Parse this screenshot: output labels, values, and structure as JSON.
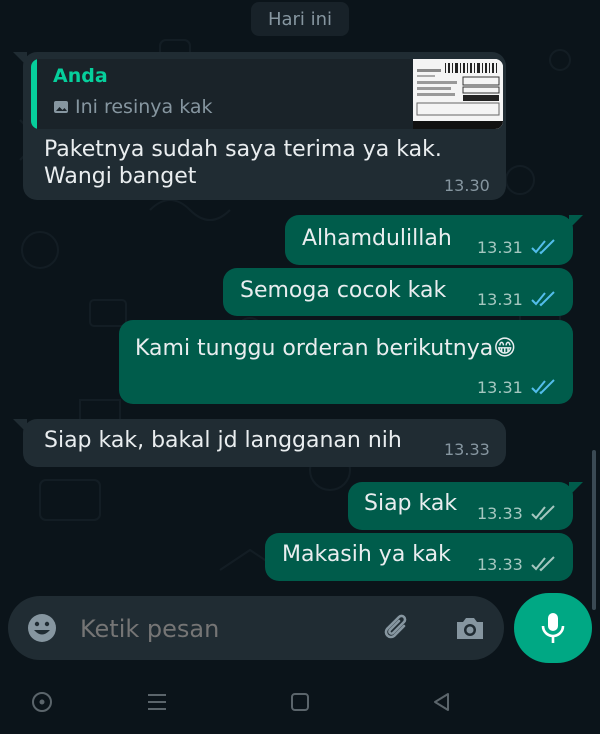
{
  "date_separator": "Hari ini",
  "messages": [
    {
      "direction": "incoming",
      "quote": {
        "name": "Anda",
        "subtitle": "Ini resinya kak"
      },
      "text_lines": [
        "Paketnya sudah saya terima ya kak.",
        "Wangi banget"
      ],
      "time": "13.30"
    },
    {
      "direction": "outgoing",
      "text": "Alhamdulillah",
      "time": "13.31",
      "status": "read"
    },
    {
      "direction": "outgoing",
      "text": "Semoga cocok kak",
      "time": "13.31",
      "status": "read"
    },
    {
      "direction": "outgoing",
      "text": "Kami tunggu orderan berikutnya😁",
      "time": "13.31",
      "status": "read"
    },
    {
      "direction": "incoming",
      "text": "Siap kak, bakal jd langganan nih",
      "time": "13.33"
    },
    {
      "direction": "outgoing",
      "text": "Siap kak",
      "time": "13.33",
      "status": "delivered"
    },
    {
      "direction": "outgoing",
      "text": "Makasih ya kak",
      "time": "13.33",
      "status": "delivered"
    }
  ],
  "composer": {
    "placeholder": "Ketik pesan"
  },
  "colors": {
    "background": "#0b141a",
    "incoming_bubble": "#202c33",
    "outgoing_bubble": "#005c4b",
    "accent": "#00a884",
    "quote_name": "#06cf9c",
    "read_ticks": "#53bdeb",
    "delivered_ticks": "#a5c7c0"
  },
  "icons": [
    "emoji-icon",
    "attach-icon",
    "camera-icon",
    "mic-icon",
    "nav-accessibility-icon",
    "nav-recents-icon",
    "nav-home-icon",
    "nav-back-icon",
    "read-ticks-icon",
    "delivered-ticks-icon",
    "image-icon"
  ]
}
